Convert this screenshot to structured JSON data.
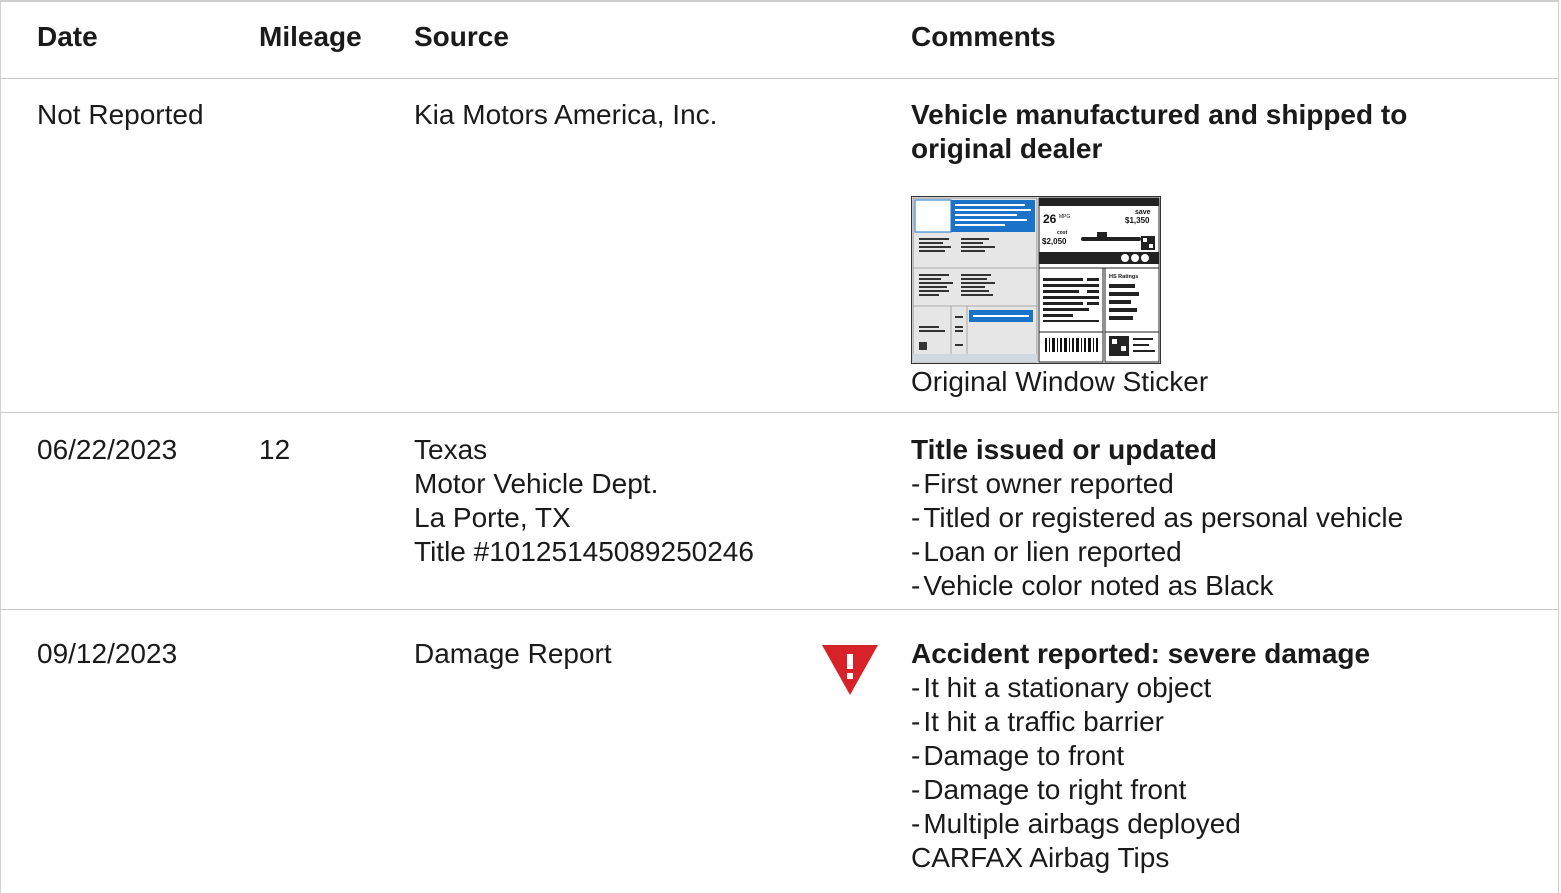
{
  "headers": {
    "date": "Date",
    "mileage": "Mileage",
    "source": "Source",
    "comments": "Comments"
  },
  "rows": [
    {
      "date": "Not Reported",
      "mileage": "",
      "source": [
        "Kia Motors America, Inc."
      ],
      "comment_title": "Vehicle manufactured and shipped to original dealer",
      "comment_title_lines": [
        "Vehicle manufactured and shipped to",
        "original dealer"
      ],
      "sticker_link": "Original Window Sticker",
      "sticker_text": {
        "mpg": "26",
        "mpg_unit": "MPG",
        "save_label": "save",
        "save_value": "$1,350",
        "cost_label": "cost",
        "cost_value": "$2,050",
        "ratings_label": "HS Ratings"
      }
    },
    {
      "date": "06/22/2023",
      "mileage": "12",
      "source": [
        "Texas",
        "Motor Vehicle Dept.",
        "La Porte, TX",
        "Title #10125145089250246"
      ],
      "comment_title": "Title issued or updated",
      "bullets": [
        "First owner reported",
        "Titled or registered as personal vehicle",
        "Loan or lien reported",
        "Vehicle color noted as Black"
      ]
    },
    {
      "date": "09/12/2023",
      "mileage": "",
      "source": [
        "Damage Report"
      ],
      "comment_title": "Accident reported: severe damage",
      "bullets": [
        "It hit a stationary object",
        "It hit a traffic barrier",
        "Damage to front",
        "Damage to right front",
        "Multiple airbags deployed"
      ],
      "link": "CARFAX Airbag Tips",
      "alert_icon": "warning-triangle-icon",
      "alert_color": "#d8222a"
    }
  ]
}
